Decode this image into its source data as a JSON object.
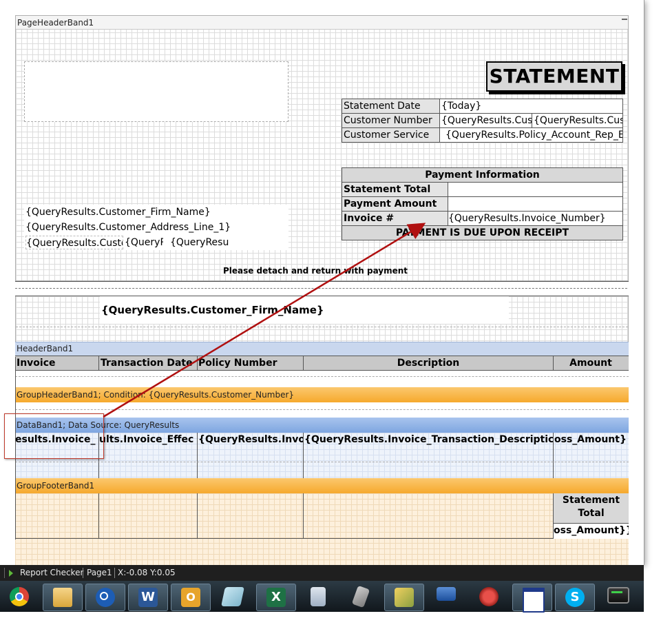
{
  "page_header": {
    "band_label": "PageHeaderBand1",
    "statement_title": "STATEMENT",
    "info_table": [
      {
        "label": "Statement Date",
        "value1": "{Today}",
        "value2": ""
      },
      {
        "label": "Customer Number",
        "value1": "{QueryResults.Cust",
        "value2": "{QueryResults.Cust"
      },
      {
        "label": "Customer Service",
        "value1": "{QueryResults.Policy_Account_Rep_Em",
        "value2": ""
      }
    ],
    "payment": {
      "header": "Payment Information",
      "rows": [
        {
          "label": "Statement Total",
          "value": ""
        },
        {
          "label": "Payment Amount",
          "value": ""
        },
        {
          "label": "Invoice #",
          "value": "{QueryResults.Invoice_Number}"
        }
      ],
      "footer": "PAYMENT IS DUE UPON RECEIPT"
    },
    "address": {
      "line1": "{QueryResults.Customer_Firm_Name}",
      "line2": "{QueryResults.Customer_Address_Line_1}",
      "line3a": "{QueryResults.Custo",
      "line3b": "{QueryR",
      "line3c": "{QueryResult"
    },
    "detach_text": "Please detach and return with payment",
    "firm_name_bold": "{QueryResults.Customer_Firm_Name}"
  },
  "header_band": {
    "label": "HeaderBand1",
    "columns": [
      "Invoice",
      "Transaction Date",
      "Policy Number",
      "Description",
      "Amount"
    ]
  },
  "group_header": {
    "label": "GroupHeaderBand1; Condition: {QueryResults.Customer_Number}"
  },
  "data_band": {
    "label": "DataBand1; Data Source: QueryResults",
    "cells": [
      "esults.Invoice_",
      "ults.Invoice_Effec",
      "{QueryResults.Invo",
      "{QueryResults.Invoice_Transaction_Descriptic",
      "oss_Amount}"
    ]
  },
  "group_footer": {
    "label": "GroupFooterBand1",
    "statement_total_line1": "Statement",
    "statement_total_line2": "Total",
    "total_value": "oss_Amount}}"
  },
  "status_bar": {
    "report_checker": "Report Checker",
    "page": "Page1",
    "coords": "X:-0.08  Y:0.05"
  },
  "taskbar": {
    "apps": [
      "chrome-icon",
      "file-explorer-icon",
      "blocked-app-icon",
      "word-icon",
      "outlook-icon",
      "notepad-icon",
      "excel-icon",
      "calculator-icon",
      "tools-icon",
      "report-designer-icon",
      "remote-desktop-icon",
      "phone-icon",
      "window-icon",
      "skype-icon",
      "monitor-icon"
    ]
  },
  "colors": {
    "band_blue": "#c9d7ee",
    "band_orange": "#f8b64a",
    "data_band_blue": "#7ea6e0",
    "arrow_red": "#b01010",
    "highlight_box": "#c0392b"
  }
}
